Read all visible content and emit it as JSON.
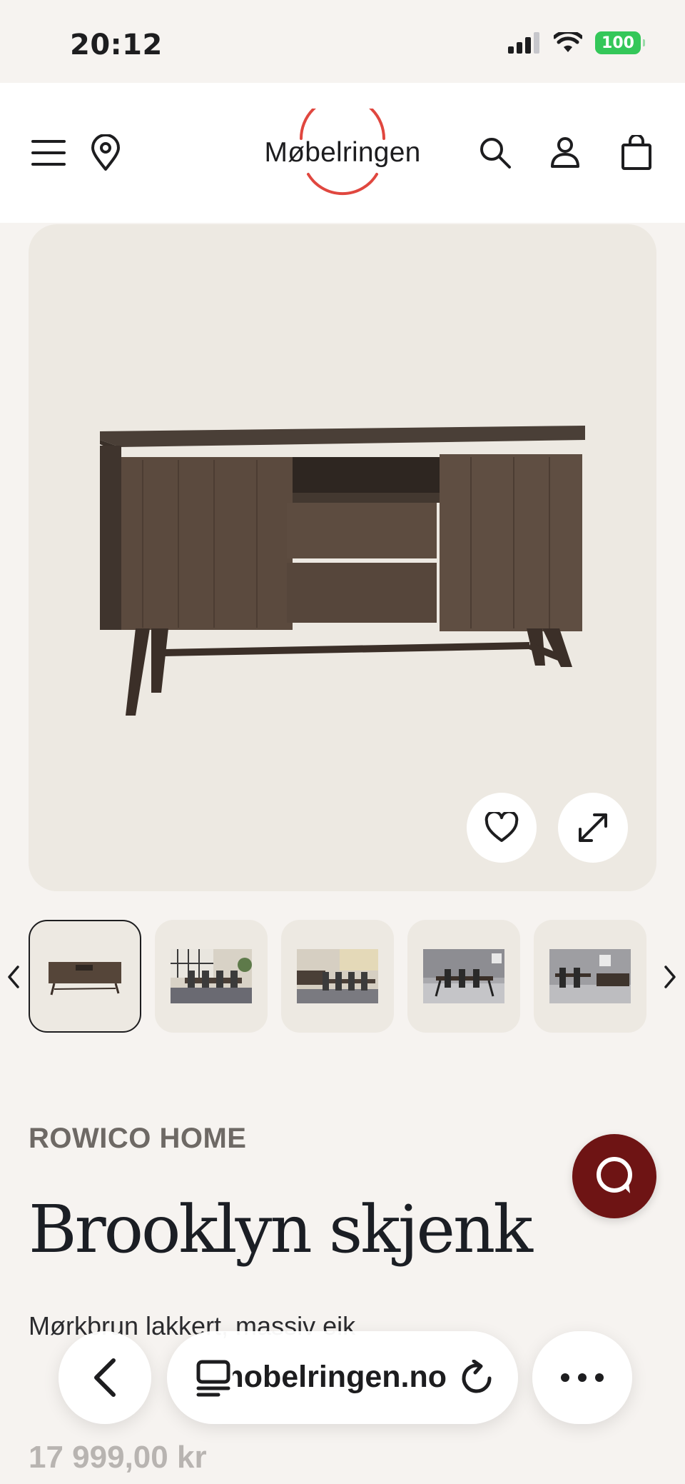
{
  "status_bar": {
    "time": "20:12",
    "battery": "100"
  },
  "header": {
    "logo": "Møbelringen"
  },
  "product": {
    "brand": "ROWICO HOME",
    "title": "Brooklyn skjenk",
    "description": "Mørkbrun lakkert, massiv eik",
    "price": "17 999,00 kr"
  },
  "thumbnails": [
    {
      "name": "sideboard",
      "selected": true
    },
    {
      "name": "dining-room-1",
      "selected": false
    },
    {
      "name": "dining-room-2",
      "selected": false
    },
    {
      "name": "dining-room-3",
      "selected": false
    },
    {
      "name": "dining-room-4",
      "selected": false
    }
  ],
  "browser": {
    "url": "mobelringen.no"
  },
  "icons": {
    "menu": "hamburger-menu-icon",
    "location": "location-pin-icon",
    "search": "search-icon",
    "account": "user-icon",
    "cart": "shopping-bag-icon",
    "favorite": "heart-icon",
    "expand": "expand-icon",
    "chat": "chat-bubble-icon"
  },
  "colors": {
    "accent": "#6e1414",
    "logo_ring": "#e0473f",
    "background": "#f6f3f0",
    "image_bg": "#ede9e2"
  }
}
